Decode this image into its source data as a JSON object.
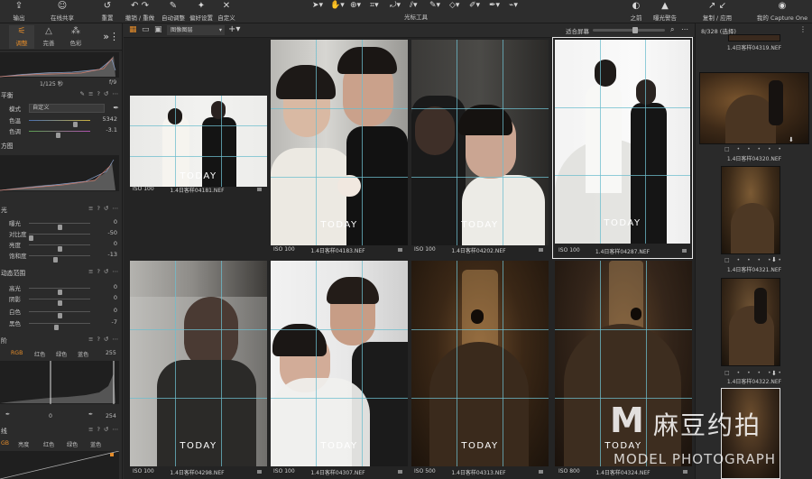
{
  "toolbar": {
    "buttons": [
      "输出",
      "在线共享",
      "重置",
      "撤销 / 重做",
      "自动调整",
      "偏好设置",
      "自定义"
    ],
    "tools_label": "光标工具",
    "right_buttons": [
      "之前",
      "曝光警告",
      "复制 / 应用"
    ],
    "app_name": "我的 Capture One"
  },
  "left_panel": {
    "tabs": [
      "调整",
      "完善",
      "色彩"
    ],
    "shutter": "1/125 秒",
    "aperture": "f/9",
    "white_balance": {
      "title": "平衡",
      "mode_label": "模式",
      "mode_value": "自定义",
      "rows": [
        {
          "label": "色温",
          "value": "5342",
          "pos": 0.78
        },
        {
          "label": "色调",
          "value": "-3.1",
          "pos": 0.47
        }
      ]
    },
    "histogram_title": "方图",
    "exposure": {
      "title": "光",
      "rows": [
        {
          "label": "曝光",
          "value": "0",
          "pos": 0.5
        },
        {
          "label": "对比度",
          "value": "-50",
          "pos": 0.0
        },
        {
          "label": "亮度",
          "value": "0",
          "pos": 0.5
        },
        {
          "label": "饱和度",
          "value": "-13",
          "pos": 0.43
        }
      ]
    },
    "hdr": {
      "title": "动态范围",
      "rows": [
        {
          "label": "高光",
          "value": "0",
          "pos": 0.5
        },
        {
          "label": "阴影",
          "value": "0",
          "pos": 0.5
        },
        {
          "label": "白色",
          "value": "0",
          "pos": 0.5
        },
        {
          "label": "黑色",
          "value": "-7",
          "pos": 0.45
        }
      ]
    },
    "levels": {
      "title": "阶",
      "channels": [
        "RGB",
        "红色",
        "绿色",
        "蓝色"
      ],
      "top_value": "255",
      "low_value": "0",
      "high_value": "254"
    },
    "curve": {
      "title": "线",
      "channels": [
        "GB",
        "亮度",
        "红色",
        "绿色",
        "蓝色"
      ]
    }
  },
  "grid": {
    "view_mode": "图像图层",
    "fit_label": "适合屏幕",
    "count": "8/328 (选择)",
    "photos": [
      {
        "iso": "ISO 100",
        "file": "1.4日客样04181.NEF",
        "watermark": "TODAY"
      },
      {
        "iso": "ISO 100",
        "file": "1.4日客样04183.NEF",
        "watermark": "TODAY"
      },
      {
        "iso": "ISO 100",
        "file": "1.4日客样04202.NEF",
        "watermark": "TODAY"
      },
      {
        "iso": "ISO 100",
        "file": "1.4日客样04287.NEF",
        "watermark": "TODAY"
      },
      {
        "iso": "ISO 100",
        "file": "1.4日客样04298.NEF",
        "watermark": "TODAY"
      },
      {
        "iso": "ISO 100",
        "file": "1.4日客样04307.NEF",
        "watermark": "TODAY"
      },
      {
        "iso": "ISO 500",
        "file": "1.4日客样04313.NEF",
        "watermark": "TODAY"
      },
      {
        "iso": "ISO 800",
        "file": "1.4日客样04324.NEF",
        "watermark": "TODAY"
      }
    ]
  },
  "filmstrip": [
    {
      "file": "1.4日客样04319.NEF"
    },
    {
      "file": "1.4日客样04320.NEF"
    },
    {
      "file": "1.4日客样04321.NEF"
    },
    {
      "file": "1.4日客样04322.NEF"
    }
  ],
  "brand": {
    "mark": "M",
    "cn": "麻豆约拍",
    "en": "MODEL PHOTOGRAPH"
  },
  "colors": {
    "accent": "#e48c2a",
    "guide": "#6ebecd",
    "selection": "#e8e8e8"
  }
}
